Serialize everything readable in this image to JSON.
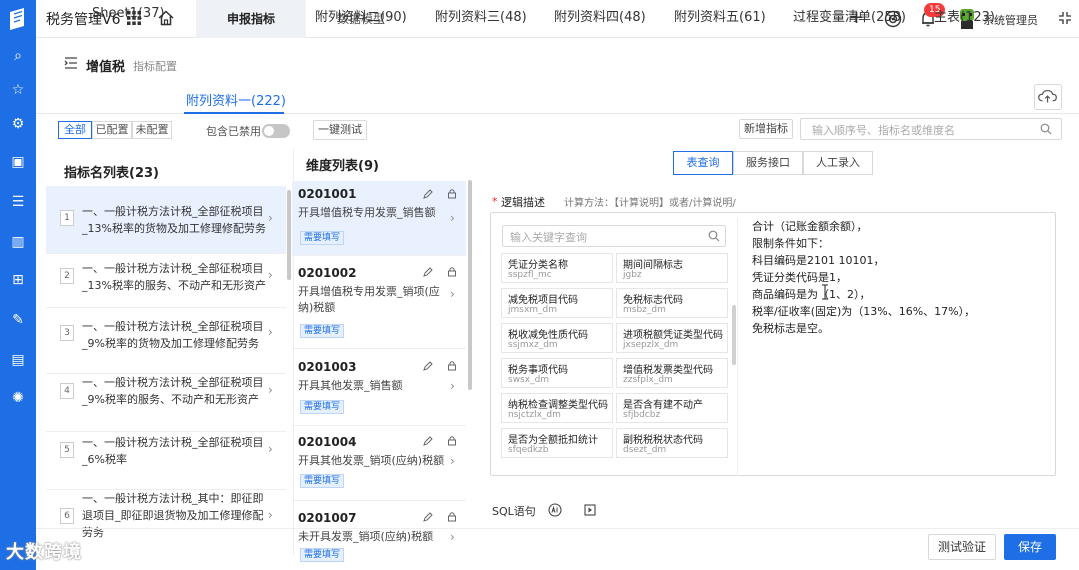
{
  "app": {
    "title": "税务管理V6"
  },
  "top_tabs": [
    "申报指标",
    "数据模型"
  ],
  "header": {
    "notif_count": "15",
    "user_name": "系统管理员"
  },
  "page": {
    "title": "增值税",
    "subtitle": "指标配置"
  },
  "sheet_tabs": [
    {
      "label": "Sheet1(37)"
    },
    {
      "label": "附列资料一(222)"
    },
    {
      "label": "附列资料二(90)"
    },
    {
      "label": "附列资料三(48)"
    },
    {
      "label": "附列资料四(48)"
    },
    {
      "label": "附列资料五(61)"
    },
    {
      "label": "过程变量清单(258)"
    },
    {
      "label": "主表(123)"
    }
  ],
  "filters": {
    "seg_all": "全部",
    "seg_configured": "已配置",
    "seg_unconfigured": "未配置",
    "disabled_label": "包含已禁用",
    "test_all": "一键测试",
    "add_indicator": "新增指标",
    "search_placeholder": "输入顺序号、指标名或维度名"
  },
  "indicators": {
    "title": "指标名列表(23)",
    "items": [
      {
        "num": "1",
        "text": "一、一般计税方法计税_全部征税项目_13%税率的货物及加工修理修配劳务"
      },
      {
        "num": "2",
        "text": "一、一般计税方法计税_全部征税项目_13%税率的服务、不动产和无形资产"
      },
      {
        "num": "3",
        "text": "一、一般计税方法计税_全部征税项目_9%税率的货物及加工修理修配劳务"
      },
      {
        "num": "4",
        "text": "一、一般计税方法计税_全部征税项目_9%税率的服务、不动产和无形资产"
      },
      {
        "num": "5",
        "text": "一、一般计税方法计税_全部征税项目_6%税率"
      },
      {
        "num": "6",
        "text": "一、一般计税方法计税_其中：即征即退项目_即征即退货物及加工修理修配劳务"
      }
    ]
  },
  "dimensions": {
    "title": "维度列表(9)",
    "items": [
      {
        "code": "0201001",
        "desc": "开具增值税专用发票_销售额",
        "tag": "需要填写"
      },
      {
        "code": "0201002",
        "desc": "开具增值税专用发票_销项(应纳)税额",
        "tag": "需要填写"
      },
      {
        "code": "0201003",
        "desc": "开具其他发票_销售额",
        "tag": "需要填写"
      },
      {
        "code": "0201004",
        "desc": "开具其他发票_销项(应纳)税额",
        "tag": "需要填写"
      },
      {
        "code": "0201007",
        "desc": "未开具发票_销项(应纳)税额",
        "tag": "需要填写"
      }
    ]
  },
  "right_tabs": [
    "表查询",
    "服务接口",
    "人工录入"
  ],
  "logic": {
    "label": "逻辑描述",
    "hint": "计算方法：【计算说明】或者/计算说明/",
    "text": "合计（记账金额余额），\n限制条件如下：\n科目编码是2101 10101，\n凭证分类代码是1，\n商品编码是为（1、2），\n税率/征收率(固定)为（13%、16%、17%），\n免税标志是空。"
  },
  "fields": {
    "search_placeholder": "输入关键字查询",
    "items": [
      {
        "name": "凭证分类名称",
        "code": "sspzfl_mc"
      },
      {
        "name": "期间间隔标志",
        "code": "jgbz"
      },
      {
        "name": "减免税项目代码",
        "code": "jmsxm_dm"
      },
      {
        "name": "免税标志代码",
        "code": "msbz_dm"
      },
      {
        "name": "税收减免性质代码",
        "code": "ssjmxz_dm"
      },
      {
        "name": "进项税额凭证类型代码",
        "code": "jxsepzlx_dm"
      },
      {
        "name": "税务事项代码",
        "code": "swsx_dm"
      },
      {
        "name": "增值税发票类型代码",
        "code": "zzsfplx_dm"
      },
      {
        "name": "纳税检查调整类型代码",
        "code": "nsjctzlx_dm"
      },
      {
        "name": "是否含有建不动产",
        "code": "sfjbdcbz"
      },
      {
        "name": "是否为全额抵扣统计",
        "code": "sfqedkzb"
      },
      {
        "name": "副税税税状态代码",
        "code": "dsezt_dm"
      }
    ]
  },
  "sql": {
    "label": "SQL语句"
  },
  "footer": {
    "test_verify": "测试验证",
    "save": "保存"
  },
  "watermark": "大数跨境",
  "colors": {
    "primary": "#1e6fe6",
    "badge": "#f23c3c",
    "active_bg": "#e8f1fd"
  }
}
